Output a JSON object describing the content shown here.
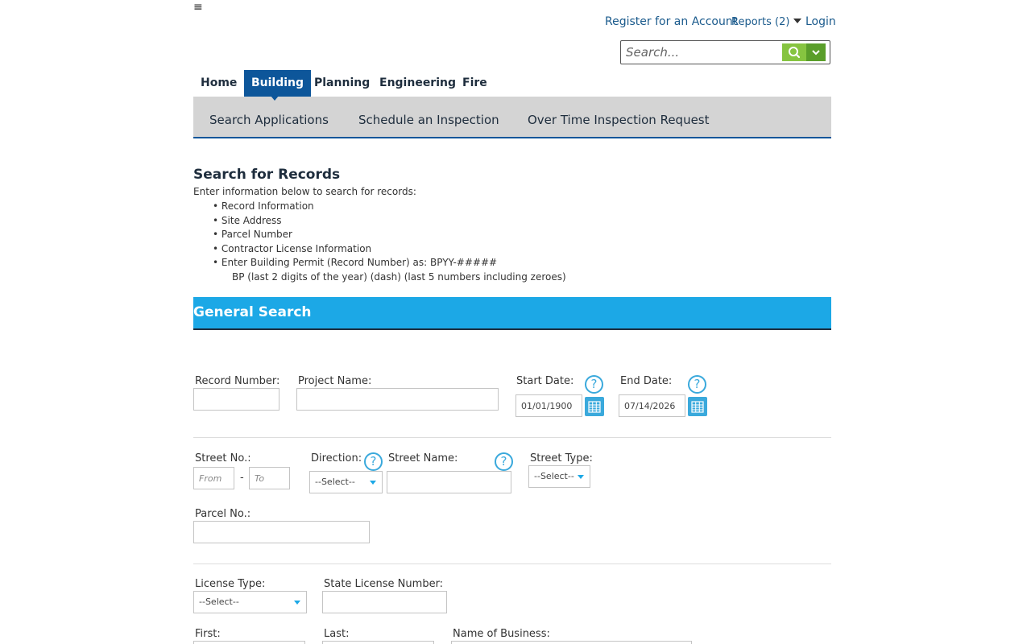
{
  "header": {
    "menu_glyph": "≡",
    "register_label": "Register for an Account",
    "reports_label": "Reports (2)",
    "login_label": "Login",
    "search_placeholder": "Search..."
  },
  "nav": {
    "tabs": [
      "Home",
      "Building",
      "Planning",
      "Engineering",
      "Fire"
    ],
    "active_tab": "Building",
    "subnav": [
      "Search Applications",
      "Schedule an Inspection",
      "Over Time Inspection Request"
    ]
  },
  "intro": {
    "title": "Search for Records",
    "description": "Enter information below to search for records:",
    "bullets": [
      "Record Information",
      "Site Address",
      "Parcel Number",
      "Contractor License Information",
      "Enter Building Permit (Record Number) as:  BPYY-#####"
    ],
    "note": "BP (last 2 digits of the year) (dash) (last 5 numbers including zeroes)"
  },
  "section": {
    "title": "General Search"
  },
  "form": {
    "record_number_label": "Record Number:",
    "project_name_label": "Project Name:",
    "start_date_label": "Start Date:",
    "start_date_value": "01/01/1900",
    "end_date_label": "End Date:",
    "end_date_value": "07/14/2026",
    "help_glyph": "?",
    "street_no_label": "Street No.:",
    "street_from_placeholder": "From",
    "street_to_placeholder": "To",
    "street_dash": "-",
    "direction_label": "Direction:",
    "direction_value": "--Select--",
    "street_name_label": "Street Name:",
    "street_type_label": "Street Type:",
    "street_type_value": "--Select--",
    "parcel_label": "Parcel No.:",
    "license_type_label": "License Type:",
    "license_type_value": "--Select--",
    "state_license_label": "State License Number:",
    "first_label": "First:",
    "last_label": "Last:",
    "business_label": "Name of Business:"
  },
  "colors": {
    "nav_active": "#0d569a",
    "section_bar": "#1ca8e6",
    "search_button": "#86c440",
    "help_icon": "#3aa9dc"
  }
}
